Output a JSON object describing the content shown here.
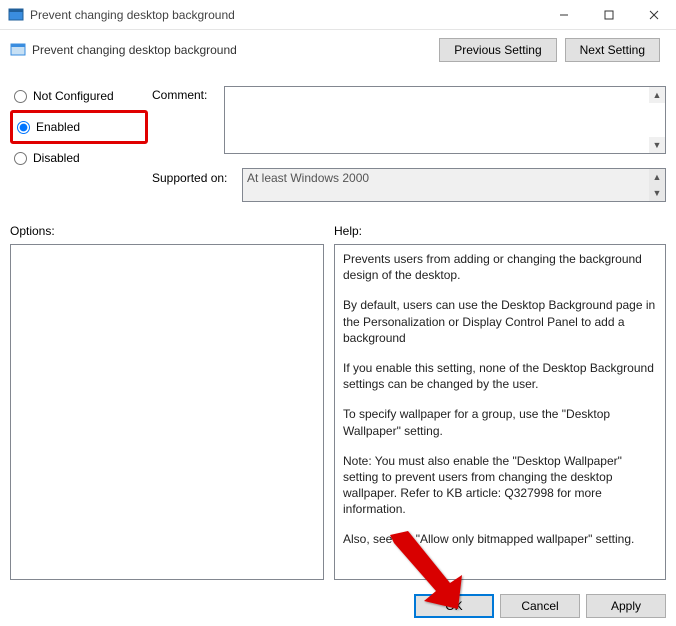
{
  "titlebar": {
    "title": "Prevent changing desktop background"
  },
  "header": {
    "title": "Prevent changing desktop background"
  },
  "nav": {
    "prev": "Previous Setting",
    "next": "Next Setting"
  },
  "radios": {
    "not_configured": "Not Configured",
    "enabled": "Enabled",
    "disabled": "Disabled"
  },
  "labels": {
    "comment": "Comment:",
    "supported": "Supported on:",
    "options": "Options:",
    "help": "Help:"
  },
  "supported_text": "At least Windows 2000",
  "help_paragraphs": {
    "p1": "Prevents users from adding or changing the background design of the desktop.",
    "p2": "By default, users can use the Desktop Background page in the Personalization or Display Control Panel to add a background",
    "p3": "If you enable this setting, none of the Desktop Background settings can be changed by the user.",
    "p4": "To specify wallpaper for a group, use the \"Desktop Wallpaper\" setting.",
    "p5": "Note: You must also enable the \"Desktop Wallpaper\" setting to prevent users from changing the desktop wallpaper. Refer to KB article: Q327998 for more information.",
    "p6": "Also, see the \"Allow only bitmapped wallpaper\" setting."
  },
  "footer": {
    "ok": "OK",
    "cancel": "Cancel",
    "apply": "Apply"
  }
}
